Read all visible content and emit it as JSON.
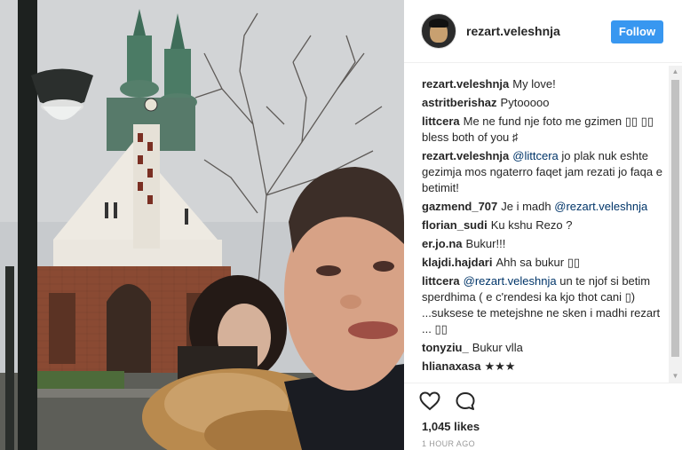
{
  "post": {
    "username": "rezart.veleshnja",
    "follow_label": "Follow",
    "likes": "1,045 likes",
    "time": "1 HOUR AGO"
  },
  "comments": [
    {
      "user": "rezart.veleshnja",
      "parts": [
        {
          "t": "My love!"
        }
      ]
    },
    {
      "user": "astritberishaz",
      "parts": [
        {
          "t": "Pytooooo"
        }
      ]
    },
    {
      "user": "littcera",
      "parts": [
        {
          "t": "Me ne fund nje foto me gzimen ▯▯ ▯▯ bless both of you ♯"
        }
      ]
    },
    {
      "user": "rezart.veleshnja",
      "parts": [
        {
          "m": "@littcera"
        },
        {
          "t": " jo plak nuk eshte gezimja mos ngaterro faqet jam rezati jo faqa e betimit!"
        }
      ]
    },
    {
      "user": "gazmend_707",
      "parts": [
        {
          "t": "Je i madh "
        },
        {
          "m": "@rezart.veleshnja"
        }
      ]
    },
    {
      "user": "florian_sudi",
      "parts": [
        {
          "t": "Ku kshu Rezo ?"
        }
      ]
    },
    {
      "user": "er.jo.na",
      "parts": [
        {
          "t": "Bukur!!!"
        }
      ]
    },
    {
      "user": "klajdi.hajdari",
      "parts": [
        {
          "t": "Ahh sa bukur ▯▯"
        }
      ]
    },
    {
      "user": "littcera",
      "parts": [
        {
          "m": "@rezart.veleshnja"
        },
        {
          "t": " un te njof si betim sperdhima ( e c'rendesi ka kjo thot cani ▯) ...suksese te metejshne ne sken i madhi rezart ... ▯▯"
        }
      ]
    },
    {
      "user": "tonyziu_",
      "parts": [
        {
          "t": "Bukur vlla"
        }
      ]
    },
    {
      "user": "hlianaxasa",
      "parts": [
        {
          "t": "★★★"
        }
      ]
    }
  ],
  "icons": {
    "like": "heart-icon",
    "comment": "comment-icon",
    "scroll_up": "scroll-up-arrow-icon",
    "scroll_down": "scroll-down-arrow-icon"
  },
  "colors": {
    "follow_bg": "#3897f0",
    "mention": "#003569",
    "muted": "#999999"
  }
}
